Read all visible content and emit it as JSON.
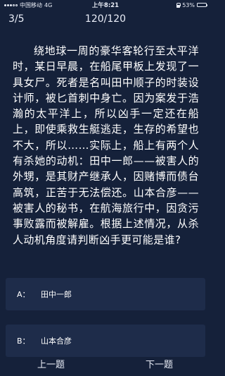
{
  "status_bar": {
    "carrier": "中国移动",
    "network": "4G",
    "time": "上午8:21",
    "battery": "53%",
    "battery_level": 0.53
  },
  "header": {
    "progress": "3/5",
    "timer": "120/120"
  },
  "question": {
    "text": "绕地球一周的豪华客轮行至太平洋时，某日早晨，在船尾甲板上发现了一具女尸。死者是名叫田中顺子的时装设计师，被匕首刺中身亡。因为案发于浩瀚的太平洋上，所以凶手一定还在船上，即使乘救生艇逃走，生存的希望也不大，所以……实际上，船上有两个人有杀她的动机：田中一郎——被害人的外甥，是其财产继承人，因赌博而债台高筑，正苦于无法偿还。山本合彦——被害人的秘书，在航海旅行中，因贪污事败露而被解雇。根据上述情况，从杀人动机角度请判断凶手更可能是谁?"
  },
  "options": [
    {
      "letter": "A：",
      "text": "田中一郎"
    },
    {
      "letter": "B：",
      "text": "山本合彦"
    }
  ],
  "nav": {
    "prev_label": "上一题",
    "next_label": "下一题"
  },
  "colors": {
    "background": "#15213a",
    "option_background": "#1e2c4a",
    "text": "#ffffff"
  }
}
